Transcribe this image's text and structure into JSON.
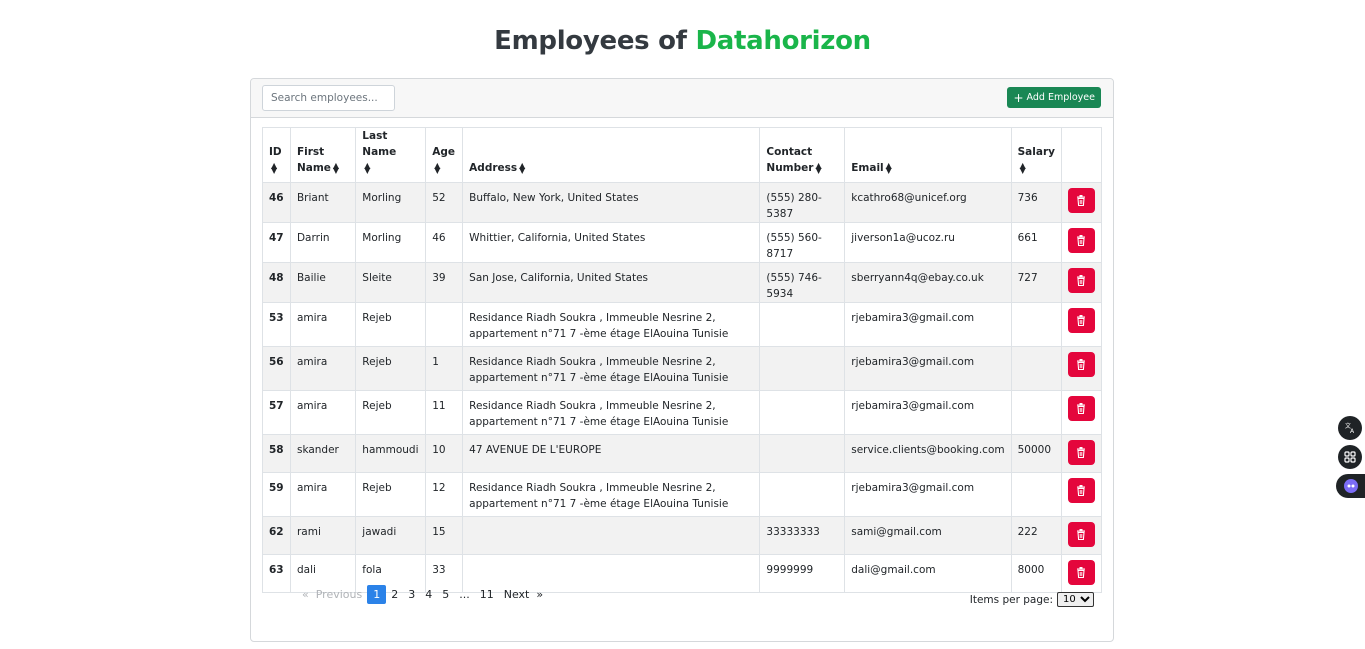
{
  "header": {
    "title_prefix": "Employees of",
    "title_brand": "Datahorizon",
    "brand_color": "#1ab54a"
  },
  "toolbar": {
    "search_placeholder": "Search employees...",
    "add_label": "Add Employee"
  },
  "table": {
    "columns": [
      {
        "key": "id",
        "line1": "ID",
        "line2": ""
      },
      {
        "key": "first",
        "line1": "First",
        "line2": "Name"
      },
      {
        "key": "last",
        "line1": "Last Name",
        "line2": ""
      },
      {
        "key": "age",
        "line1": "Age",
        "line2": ""
      },
      {
        "key": "address",
        "line1": "",
        "line2": "Address"
      },
      {
        "key": "contact",
        "line1": "Contact",
        "line2": "Number"
      },
      {
        "key": "email",
        "line1": "",
        "line2": "Email"
      },
      {
        "key": "salary",
        "line1": "Salary",
        "line2": ""
      }
    ],
    "rows": [
      {
        "id": "46",
        "first": "Briant",
        "last": "Morling",
        "age": "52",
        "address": "Buffalo, New York, United States",
        "contact": "(555) 280-5387",
        "email": "kcathro68@unicef.org",
        "salary": "736"
      },
      {
        "id": "47",
        "first": "Darrin",
        "last": "Morling",
        "age": "46",
        "address": "Whittier, California, United States",
        "contact": "(555) 560-8717",
        "email": "jiverson1a@ucoz.ru",
        "salary": "661"
      },
      {
        "id": "48",
        "first": "Bailie",
        "last": "Sleite",
        "age": "39",
        "address": "San Jose, California, United States",
        "contact": "(555) 746-5934",
        "email": "sberryann4q@ebay.co.uk",
        "salary": "727"
      },
      {
        "id": "53",
        "first": "amira",
        "last": "Rejeb",
        "age": "",
        "address": "Residance Riadh Soukra , Immeuble Nesrine 2, appartement n°71 7 -ème étage ElAouina Tunisie",
        "contact": "",
        "email": "rjebamira3@gmail.com",
        "salary": ""
      },
      {
        "id": "56",
        "first": "amira",
        "last": "Rejeb",
        "age": "1",
        "address": "Residance Riadh Soukra , Immeuble Nesrine 2, appartement n°71 7 -ème étage ElAouina Tunisie",
        "contact": "",
        "email": "rjebamira3@gmail.com",
        "salary": ""
      },
      {
        "id": "57",
        "first": "amira",
        "last": "Rejeb",
        "age": "11",
        "address": "Residance Riadh Soukra , Immeuble Nesrine 2, appartement n°71 7 -ème étage ElAouina Tunisie",
        "contact": "",
        "email": "rjebamira3@gmail.com",
        "salary": ""
      },
      {
        "id": "58",
        "first": "skander",
        "last": "hammoudi",
        "age": "10",
        "address": "47 AVENUE DE L'EUROPE",
        "contact": "",
        "email": "service.clients@booking.com",
        "salary": "50000"
      },
      {
        "id": "59",
        "first": "amira",
        "last": "Rejeb",
        "age": "12",
        "address": "Residance Riadh Soukra , Immeuble Nesrine 2, appartement n°71 7 -ème étage ElAouina Tunisie",
        "contact": "",
        "email": "rjebamira3@gmail.com",
        "salary": ""
      },
      {
        "id": "62",
        "first": "rami",
        "last": "jawadi",
        "age": "15",
        "address": "",
        "contact": "33333333",
        "email": "sami@gmail.com",
        "salary": "222"
      },
      {
        "id": "63",
        "first": "dali",
        "last": "fola",
        "age": "33",
        "address": "",
        "contact": "9999999",
        "email": "dali@gmail.com",
        "salary": "8000"
      }
    ]
  },
  "pagination": {
    "previous_label": "«  Previous",
    "next_label": "Next  »",
    "pages": [
      "1",
      "2",
      "3",
      "4",
      "5",
      "...",
      "11"
    ],
    "current": "1"
  },
  "items_per_page": {
    "label": "Items per page:",
    "selected": "10"
  },
  "side_widgets": [
    "translate-icon",
    "apps-icon",
    "assistant-icon"
  ]
}
